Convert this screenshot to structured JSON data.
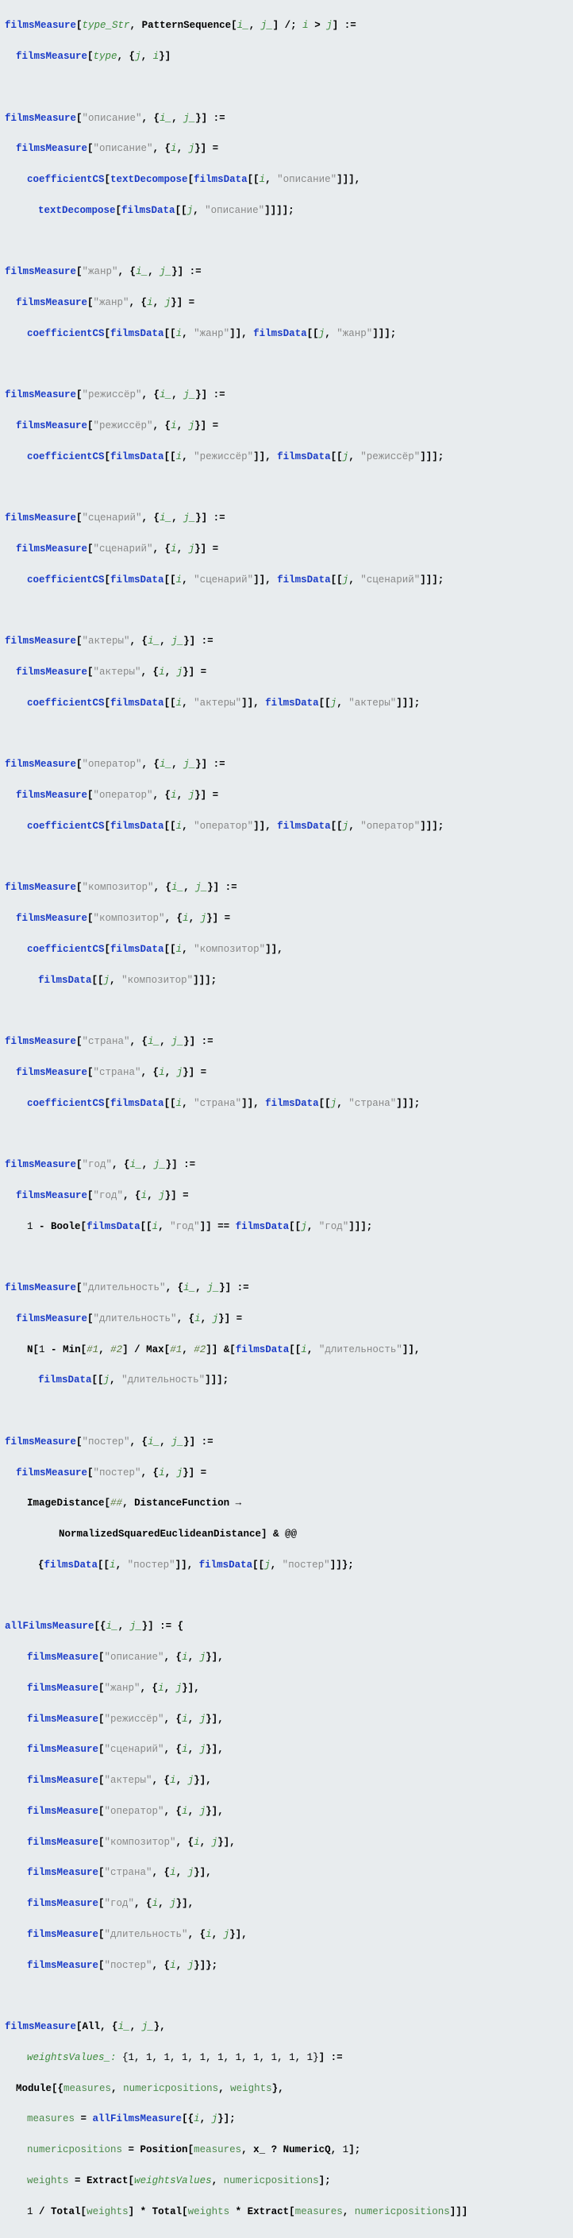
{
  "s": {
    "opisanie": "\"описание\"",
    "zhanr": "\"жанр\"",
    "rezhisser": "\"режиссёр\"",
    "scenariy": "\"сценарий\"",
    "aktery": "\"актеры\"",
    "operator": "\"оператор\"",
    "kompozitor": "\"композитор\"",
    "strana": "\"страна\"",
    "god": "\"год\"",
    "dlitelnost": "\"длительность\"",
    "poster": "\"постер\""
  },
  "sym": {
    "filmsMeasure": "filmsMeasure",
    "allFilmsMeasure": "allFilmsMeasure",
    "coefficientCS": "coefficientCS",
    "textDecompose": "textDecompose",
    "filmsData": "filmsData",
    "PatternSequence": "PatternSequence",
    "Boole": "Boole",
    "Min": "Min",
    "Max": "Max",
    "N": "N",
    "ImageDistance": "ImageDistance",
    "DistanceFunction": "DistanceFunction",
    "NSED": "NormalizedSquaredEuclideanDistance",
    "Module": "Module",
    "Position": "Position",
    "NumericQ": "NumericQ",
    "Extract": "Extract",
    "Total": "Total",
    "All": "All",
    "type": "type",
    "type_Str": "type_Str",
    "i_": "i_",
    "j_": "j_",
    "i": "i",
    "j": "j",
    "slot1": "#1",
    "slot2": "#2",
    "slotseq": "##",
    "measures": "measures",
    "numericpositions": "numericpositions",
    "weights": "weights",
    "weightsValues": "weightsValues",
    "weightsValues_": "weightsValues_:",
    "x_": "x_"
  },
  "num": {
    "one": "1",
    "weightsDefault": "{1, 1, 1, 1, 1, 1, 1, 1, 1, 1, 1}"
  }
}
